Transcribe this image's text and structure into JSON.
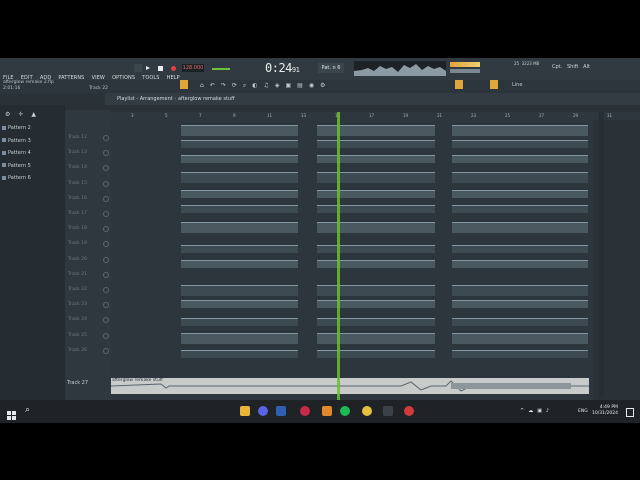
{
  "menubar": {
    "items": [
      "FILE",
      "EDIT",
      "ADD",
      "PATTERNS",
      "VIEW",
      "OPTIONS",
      "TOOLS",
      "HELP"
    ],
    "tempo": "128.000",
    "time": "0:24",
    "time_sub": "91",
    "pattern": "Pat. n 6",
    "cpu_ram": "3223 MB",
    "cpu_val": "25",
    "right_buttons": [
      "Cpt.",
      "Shift",
      "Alt"
    ]
  },
  "file_info": {
    "name": "afterglow remake 2.flp",
    "time": "2:01:16",
    "track": "Track 22"
  },
  "playlist": {
    "label": "Playlist - Arrangement",
    "project": "afterglow remake stuff",
    "ruler": [
      "3",
      "5",
      "7",
      "9",
      "11",
      "13",
      "15",
      "17",
      "19",
      "21",
      "23",
      "25",
      "27",
      "29",
      "31"
    ]
  },
  "patterns": [
    "Pattern 2",
    "Pattern 3",
    "Pattern 4",
    "Pattern 5",
    "Pattern 6"
  ],
  "tracks": [
    "Track 12",
    "Track 13",
    "Track 14",
    "Track 15",
    "Track 16",
    "Track 17",
    "Track 18",
    "Track 19",
    "Track 20",
    "Track 21",
    "Track 22",
    "Track 23",
    "Track 24",
    "Track 25",
    "Track 26"
  ],
  "track27": "Track 27",
  "audio_clip": "afterglow remake stuff",
  "taskbar": {
    "lang": "ENG",
    "time": "4:49 PM",
    "date": "10/31/2024"
  }
}
